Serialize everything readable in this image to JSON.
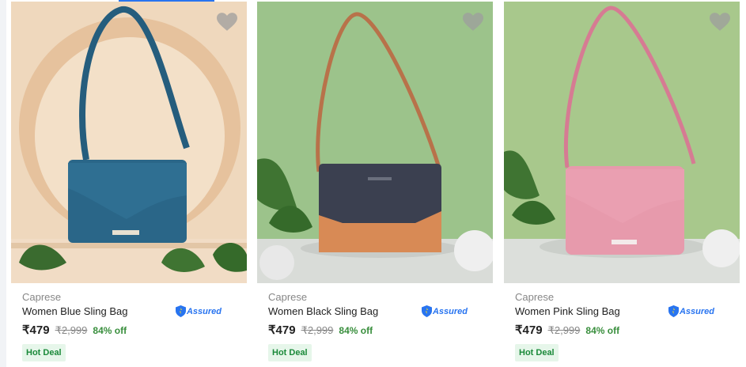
{
  "products": [
    {
      "brand": "Caprese",
      "title": "Women Blue Sling Bag",
      "price": "₹479",
      "mrp": "₹2,999",
      "discount": "84% off",
      "badge": "Hot Deal",
      "assured_label": "Assured",
      "bag_color": "#2a6688",
      "bg_color": "#efd8bd",
      "logo_text": "CAPRESE"
    },
    {
      "brand": "Caprese",
      "title": "Women Black Sling Bag",
      "price": "₹479",
      "mrp": "₹2,999",
      "discount": "84% off",
      "badge": "Hot Deal",
      "assured_label": "Assured",
      "bag_color": "#3b4050",
      "bg_color": "#9cc38b",
      "logo_text": "CAPRESE"
    },
    {
      "brand": "Caprese",
      "title": "Women Pink Sling Bag",
      "price": "₹479",
      "mrp": "₹2,999",
      "discount": "84% off",
      "badge": "Hot Deal",
      "assured_label": "Assured",
      "bag_color": "#e79aac",
      "bg_color": "#a8c88c",
      "logo_text": "CAPRESE"
    }
  ],
  "icons": {
    "wishlist": "heart-icon",
    "assured": "assured-shield-icon"
  }
}
